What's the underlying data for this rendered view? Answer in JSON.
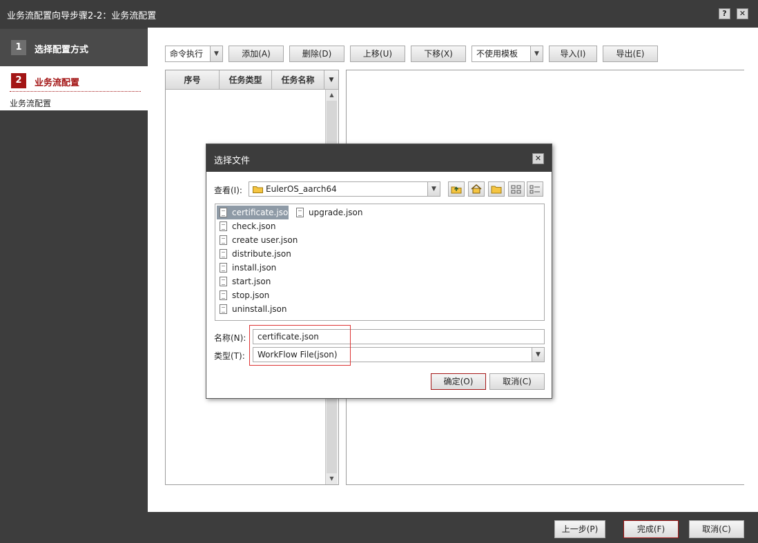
{
  "window": {
    "title": "业务流配置向导步骤2-2：业务流配置",
    "help_label": "?",
    "close_label": "✕"
  },
  "sidebar": {
    "steps": [
      {
        "num": "1",
        "label": "选择配置方式"
      },
      {
        "num": "2",
        "label": "业务流配置",
        "sub": "业务流配置"
      }
    ]
  },
  "toolbar": {
    "exec_select": "命令执行",
    "add": "添加(A)",
    "delete": "删除(D)",
    "up": "上移(U)",
    "down": "下移(X)",
    "template_select": "不使用模板",
    "import": "导入(I)",
    "export": "导出(E)"
  },
  "table": {
    "columns": [
      "序号",
      "任务类型",
      "任务名称"
    ]
  },
  "footer": {
    "prev": "上一步(P)",
    "finish": "完成(F)",
    "cancel": "取消(C)"
  },
  "dialog": {
    "title": "选择文件",
    "close_label": "✕",
    "look_in_label": "查看(I):",
    "look_in_value": "EulerOS_aarch64",
    "files_col1": [
      "certificate.json",
      "check.json",
      "create user.json",
      "distribute.json",
      "install.json",
      "start.json",
      "stop.json",
      "uninstall.json"
    ],
    "files_col2": [
      "upgrade.json"
    ],
    "selected_file": "certificate.json",
    "name_label": "名称(N):",
    "name_value": "certificate.json",
    "type_label": "类型(T):",
    "type_value": "WorkFlow File(json)",
    "ok": "确定(O)",
    "cancel": "取消(C)"
  },
  "colors": {
    "accent_red": "#a31515",
    "title_bar": "#3c3c3c",
    "sidebar": "#3d3d3d"
  }
}
